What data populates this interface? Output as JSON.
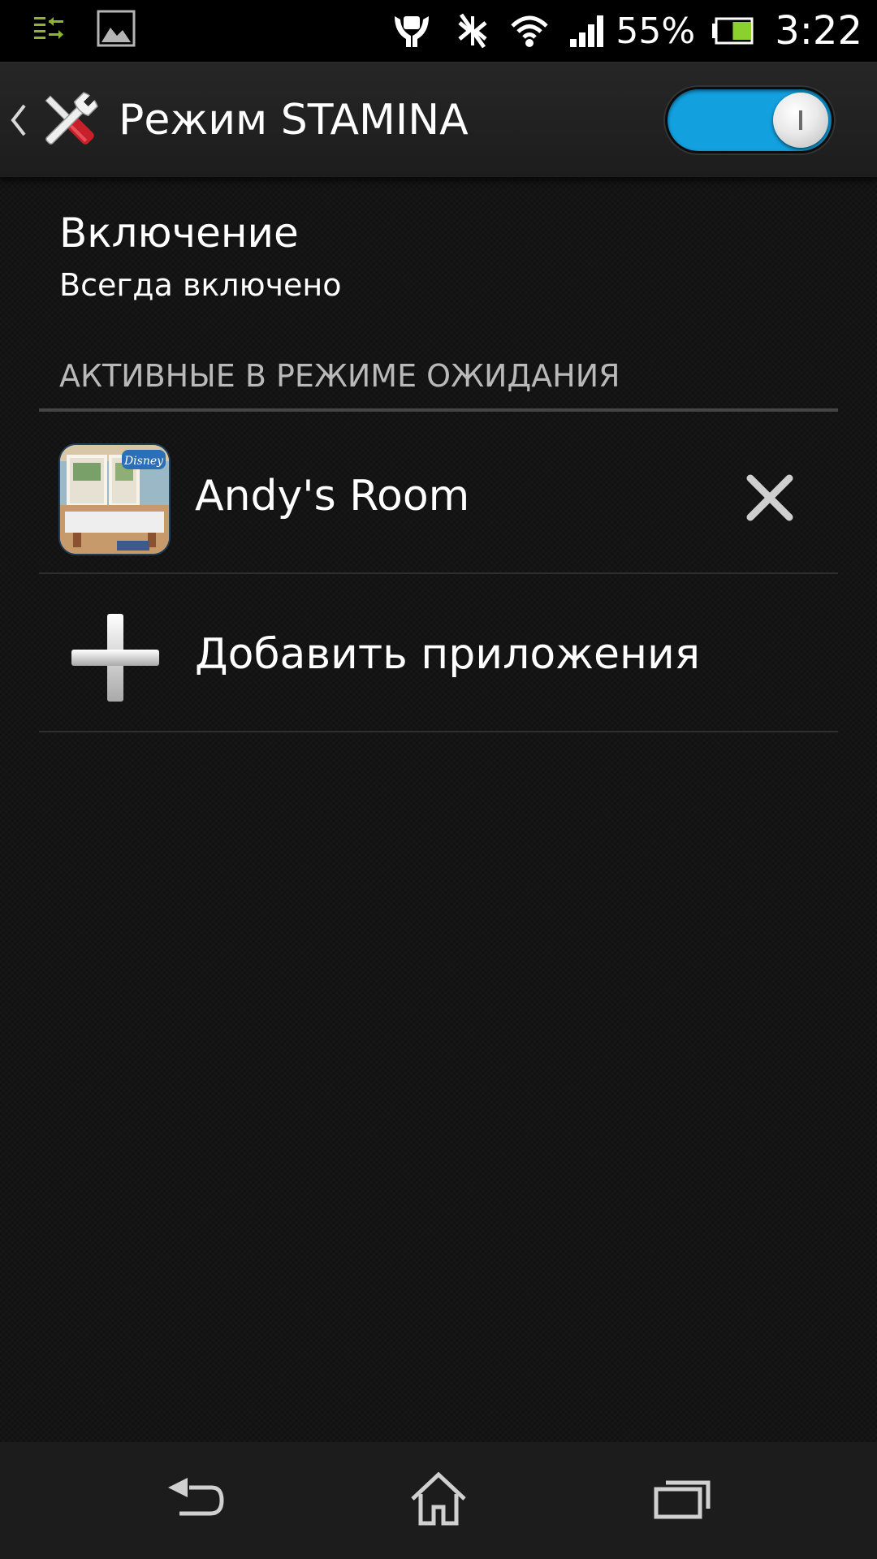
{
  "status_bar": {
    "notification_icons": [
      "transfer-arrows-icon",
      "image-notification-icon"
    ],
    "system_icons": [
      "stamina-hands-icon",
      "no-sync-icon",
      "wifi-icon",
      "signal-icon"
    ],
    "battery_percent": "55%",
    "battery_level": 0.55,
    "time": "3:22"
  },
  "action_bar": {
    "title": "Режим STAMINA",
    "app_icon": "tools-settings-icon",
    "toggle_on": true,
    "colors": {
      "toggle_accent": "#12a0df"
    }
  },
  "activation": {
    "title": "Включение",
    "summary": "Всегда включено"
  },
  "standby_section": {
    "header": "АКТИВНЫЕ В РЕЖИМЕ ОЖИДАНИЯ",
    "apps": [
      {
        "name": "Andy's Room",
        "icon": "disney-app-icon",
        "action_icon": "close-icon"
      }
    ],
    "add_label": "Добавить приложения",
    "add_icon": "plus-icon"
  },
  "nav_bar": {
    "buttons": [
      "back-icon",
      "home-icon",
      "recent-apps-icon"
    ]
  }
}
